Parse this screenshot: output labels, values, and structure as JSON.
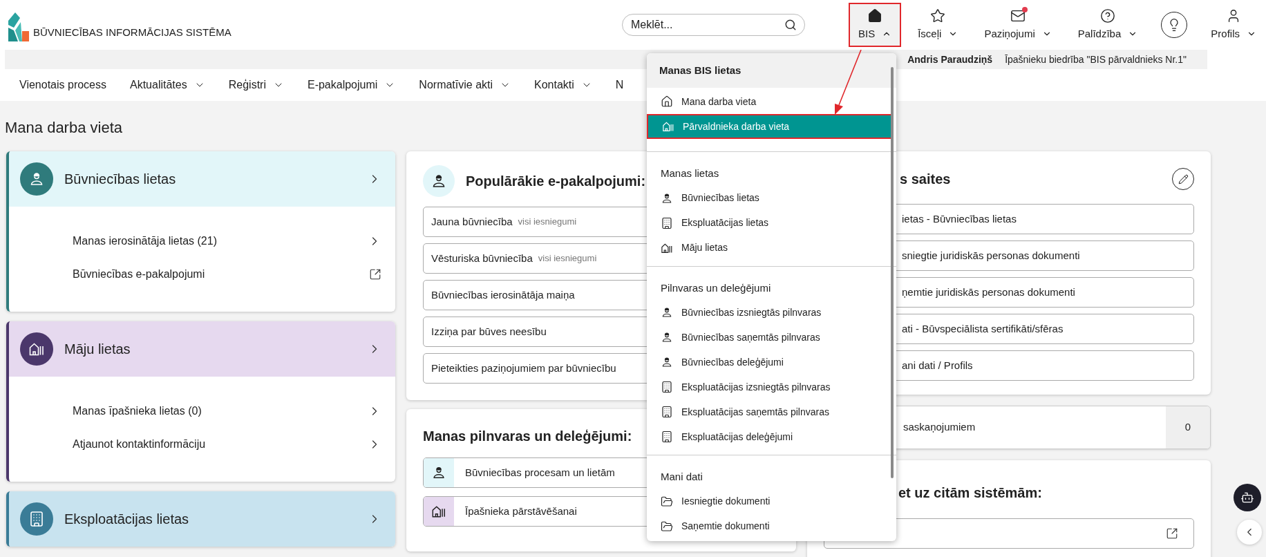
{
  "logo": {
    "title": "BŪVNIECĪBAS INFORMĀCIJAS SISTĒMA"
  },
  "search": {
    "placeholder": "Meklēt..."
  },
  "top_menu": [
    {
      "label": "BIS",
      "expanded": true,
      "unread": false
    },
    {
      "label": "Īsceļi",
      "expanded": false,
      "unread": false
    },
    {
      "label": "Paziņojumi",
      "expanded": false,
      "unread": true
    },
    {
      "label": "Palīdzība",
      "expanded": false,
      "unread": false
    },
    {
      "label": "Profils",
      "expanded": false,
      "unread": false
    }
  ],
  "user_bar": {
    "name": "Andris Paraudziņš",
    "organization": "Īpašnieku biedrība \"BIS pārvaldnieks Nr.1\""
  },
  "nav": [
    {
      "label": "Vienotais process",
      "has_menu": false
    },
    {
      "label": "Aktualitātes",
      "has_menu": true
    },
    {
      "label": "Reģistri",
      "has_menu": true
    },
    {
      "label": "E-pakalpojumi",
      "has_menu": true
    },
    {
      "label": "Normatīvie akti",
      "has_menu": true
    },
    {
      "label": "Kontakti",
      "has_menu": true
    },
    {
      "label": "N",
      "has_menu": false
    }
  ],
  "page_title": "Mana darba vieta",
  "case_cards": [
    {
      "title": "Būvniecības lietas",
      "kind": "construction",
      "color": "#2f7b7c",
      "links": [
        {
          "label": "Manas ierosinātāja lietas (21)",
          "external": false
        },
        {
          "label": "Būvniecības e-pakalpojumi",
          "external": true
        }
      ]
    },
    {
      "title": "Māju lietas",
      "kind": "house",
      "color": "#4b376b",
      "links": [
        {
          "label": "Manas īpašnieka lietas (0)",
          "external": false
        },
        {
          "label": "Atjaunot kontaktinformāciju",
          "external": false
        }
      ]
    },
    {
      "title": "Eksploatācijas lietas",
      "kind": "building",
      "color": "#3a7c97"
    }
  ],
  "popular_services": {
    "title": "Populārākie e-pakalpojumi:",
    "items": [
      {
        "label": "Jauna būvniecība",
        "note": "visi iesniegumi"
      },
      {
        "label": "Vēsturiska būvniecība",
        "note": "visi iesniegumi"
      },
      {
        "label": "Būvniecības ierosinātāja maiņa"
      },
      {
        "label": "Izziņa par būves neesību"
      },
      {
        "label": "Pieteikties paziņojumiem par būvniecību"
      }
    ]
  },
  "authorizations": {
    "title": "Manas pilnvaras un deleģējumi:",
    "items": [
      {
        "label": "Būvniecības procesam un lietām",
        "kind": "construction"
      },
      {
        "label": "Īpašnieka pārstāvēšanai",
        "kind": "house"
      }
    ]
  },
  "quick_links": {
    "title": "s saites",
    "items": [
      "ietas - Būvniecības lietas",
      "sniegtie juridiskās personas dokumenti",
      "ņemtie juridiskās personas dokumenti",
      "ati - Būvspeciālista sertifikāti/sfēras",
      "ani dati / Profils"
    ]
  },
  "approvals": {
    "label": "saskaņojumiem",
    "count": "0"
  },
  "other_systems": {
    "title": "et uz citām sistēmām:"
  },
  "dropdown": {
    "sections": [
      {
        "kind": "header",
        "title": "Manas BIS lietas",
        "items": [
          {
            "label": "Mana darba vieta",
            "kind": "home",
            "selected": false
          },
          {
            "label": "Pārvaldnieka darba vieta",
            "kind": "house",
            "selected": true
          }
        ]
      },
      {
        "kind": "group",
        "title": "Manas lietas",
        "items": [
          {
            "label": "Būvniecības lietas",
            "kind": "construction",
            "selected": false
          },
          {
            "label": "Ekspluatācijas lietas",
            "kind": "building",
            "selected": false
          },
          {
            "label": "Māju lietas",
            "kind": "house",
            "selected": false
          }
        ]
      },
      {
        "kind": "group",
        "title": "Pilnvaras un deleģējumi",
        "items": [
          {
            "label": "Būvniecības izsniegtās pilnvaras",
            "kind": "construction",
            "selected": false
          },
          {
            "label": "Būvniecības saņemtās pilnvaras",
            "kind": "construction",
            "selected": false
          },
          {
            "label": "Būvniecības deleģējumi",
            "kind": "construction",
            "selected": false
          },
          {
            "label": "Ekspluatācijas izsniegtās pilnvaras",
            "kind": "building",
            "selected": false
          },
          {
            "label": "Ekspluatācijas saņemtās pilnvaras",
            "kind": "building",
            "selected": false
          },
          {
            "label": "Ekspluatācijas deleģējumi",
            "kind": "building",
            "selected": false
          }
        ]
      },
      {
        "kind": "group",
        "title": "Mani dati",
        "items": [
          {
            "label": "Iesniegtie dokumenti",
            "kind": "folder",
            "selected": false
          },
          {
            "label": "Saņemtie dokumenti",
            "kind": "folder",
            "selected": false
          }
        ]
      }
    ]
  }
}
